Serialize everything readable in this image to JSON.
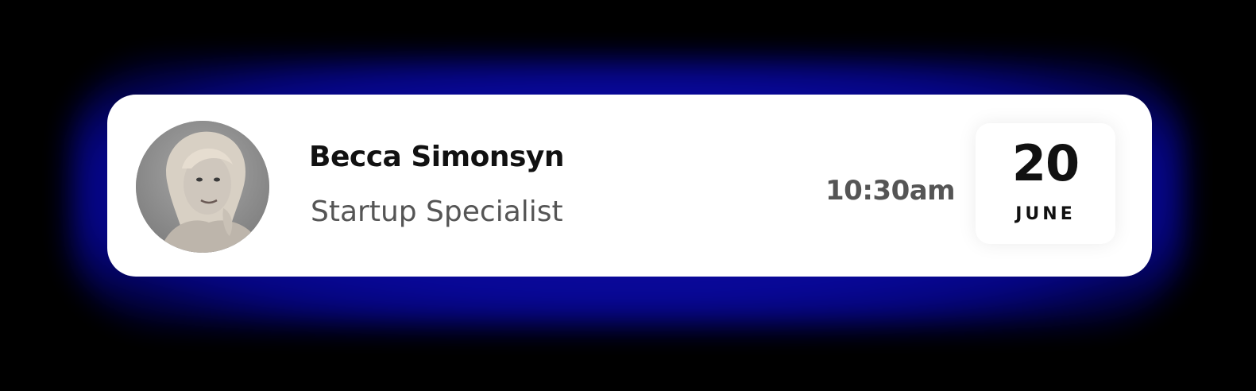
{
  "profile": {
    "name": "Becca Simonsyn",
    "role": "Startup Specialist",
    "avatar_icon": "user-photo"
  },
  "appointment": {
    "time": "10:30am",
    "day": "20",
    "month": "JUNE"
  },
  "colors": {
    "background": "#000000",
    "glow": "#0b0aa8",
    "card": "#ffffff",
    "name_text": "#111111",
    "secondary_text": "#555555"
  }
}
